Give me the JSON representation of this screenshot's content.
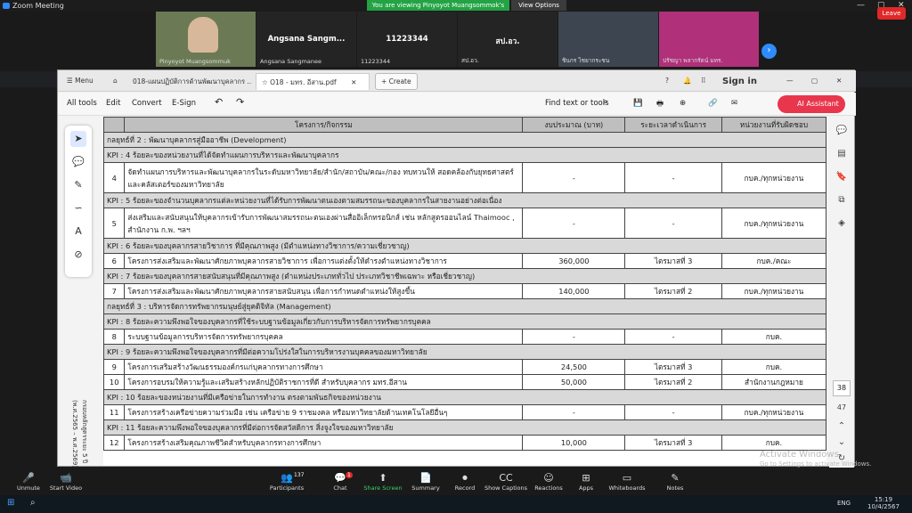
{
  "zoom": {
    "title": "Zoom Meeting",
    "share_banner": "You are viewing Pinyoyot Muangsommok's screen",
    "view_options": "View Options",
    "participants": [
      {
        "name": "Pinyoyot Muangsommuk",
        "big": ""
      },
      {
        "name": "Angsana Sangmanee",
        "big": "Angsana Sangm..."
      },
      {
        "name": "11223344",
        "big": "11223344"
      },
      {
        "name": "สป.อว.",
        "big": "สป.อว."
      },
      {
        "name": "ชินกร ไชยากระชน",
        "big": ""
      },
      {
        "name": "ปรัชญา พลากรัตน์ มทร.",
        "big": ""
      }
    ],
    "bottom": [
      {
        "label": "Unmute",
        "icon": "mic-off-icon",
        "glyph": "🎤"
      },
      {
        "label": "Start Video",
        "icon": "video-off-icon",
        "glyph": "📹"
      },
      {
        "label": "Participants",
        "icon": "participants-icon",
        "glyph": "👥",
        "badge": "137"
      },
      {
        "label": "Chat",
        "icon": "chat-icon",
        "glyph": "💬",
        "badge": "1"
      },
      {
        "label": "Share Screen",
        "icon": "share-icon",
        "glyph": "⬆"
      },
      {
        "label": "Summary",
        "icon": "summary-icon",
        "glyph": "📄"
      },
      {
        "label": "Record",
        "icon": "record-icon",
        "glyph": "⏺"
      },
      {
        "label": "Show Captions",
        "icon": "captions-icon",
        "glyph": "CC"
      },
      {
        "label": "Reactions",
        "icon": "reactions-icon",
        "glyph": "☺"
      },
      {
        "label": "Apps",
        "icon": "apps-icon",
        "glyph": "⊞"
      },
      {
        "label": "Whiteboards",
        "icon": "whiteboard-icon",
        "glyph": "▭"
      },
      {
        "label": "Notes",
        "icon": "notes-icon",
        "glyph": "✎"
      }
    ],
    "leave": "Leave"
  },
  "pdf": {
    "tabs": [
      "Menu",
      "018-แผนปฏิบัติการด้านพัฒนาบุคลากร ...",
      "O18 - มทร. อีสาน.pdf",
      "Create"
    ],
    "toolbar": [
      "All tools",
      "Edit",
      "Convert",
      "E-Sign"
    ],
    "find": "Find text or tools",
    "sign_in": "Sign in",
    "ai_assistant": "AI Assistant",
    "page_current": "38",
    "page_total": "47",
    "side_text": "กรอบหลักสูตรระยะ 5 ปี (พ.ศ.2565 – พ.ศ.2569)",
    "headers": [
      "",
      "โครงการ/กิจกรรม",
      "งบประมาณ (บาท)",
      "ระยะเวลาดำเนินการ",
      "หน่วยงานที่รับผิดชอบ"
    ],
    "rows": [
      {
        "kind": "grp",
        "text": "กลยุทธ์ที่ 2 : พัฒนาบุคลากรสู่มืออาชีพ (Development)"
      },
      {
        "kind": "kpi",
        "text": "KPI : 4 ร้อยละของหน่วยงานที่ได้จัดทำแผนการบริหารและพัฒนาบุคลากร"
      },
      {
        "kind": "row",
        "no": "4",
        "text": "จัดทำแผนการบริหารและพัฒนาบุคลากรในระดับมหาวิทยาลัย/สำนัก/สถาบัน/คณะ/กอง ทบทวนให้ สอดคล้องกับยุทธศาสตร์และคลัสเตอร์ของมหาวิทยาลัย",
        "budget": "-",
        "period": "-",
        "unit": "กบค./ทุกหน่วยงาน",
        "tall": true
      },
      {
        "kind": "kpi",
        "text": "KPI : 5 ร้อยละของจำนวนบุคลากรแต่ละหน่วยงานที่ได้รับการพัฒนาตนเองตามสมรรถนะของบุคลากรในสายงานอย่างต่อเนื่อง"
      },
      {
        "kind": "row",
        "no": "5",
        "text": "ส่งเสริมและสนับสนุนให้บุคลากรเข้ารับการพัฒนาสมรรถนะตนเองผ่านสื่ออิเล็กทรอนิกส์ เช่น หลักสูตรออนไลน์ Thaimooc , สำนักงาน ก.พ. ฯลฯ",
        "budget": "-",
        "period": "-",
        "unit": "กบค./ทุกหน่วยงาน",
        "tall": true
      },
      {
        "kind": "kpi",
        "text": "KPI : 6 ร้อยละของบุคลากรสายวิชาการ ที่มีคุณภาพสูง (มีตำแหน่งทางวิชาการ/ความเชี่ยวชาญ)"
      },
      {
        "kind": "row",
        "no": "6",
        "text": "โครงการส่งเสริมและพัฒนาศักยภาพบุคลากรสายวิชาการ เพื่อการแต่งตั้งให้ดำรงตำแหน่งทางวิชาการ",
        "budget": "360,000",
        "period": "ไตรมาสที่ 3",
        "unit": "กบค./คณะ"
      },
      {
        "kind": "kpi",
        "text": "KPI : 7 ร้อยละของบุคลากรสายสนับสนุนที่มีคุณภาพสูง (ตำแหน่งประเภททั่วไป ประเภทวิชาชีพเฉพาะ หรือเชี่ยวชาญ)"
      },
      {
        "kind": "row",
        "no": "7",
        "text": "โครงการส่งเสริมและพัฒนาศักยภาพบุคลากรสายสนับสนุน เพื่อการกำหนดตำแหน่งให้สูงขึ้น",
        "budget": "140,000",
        "period": "ไตรมาสที่ 2",
        "unit": "กบค./ทุกหน่วยงาน"
      },
      {
        "kind": "grp",
        "text": "กลยุทธ์ที่ 3 : บริหารจัดการทรัพยากรมนุษย์สู่ยุคดิจิทัล (Management)"
      },
      {
        "kind": "kpi",
        "text": "KPI : 8 ร้อยละความพึงพอใจของบุคลากรที่ใช้ระบบฐานข้อมูลเกี่ยวกับการบริหารจัดการทรัพยากรบุคคล"
      },
      {
        "kind": "row",
        "no": "8",
        "text": "ระบบฐานข้อมูลการบริหารจัดการทรัพยากรบุคคล",
        "budget": "-",
        "period": "-",
        "unit": "กบค."
      },
      {
        "kind": "kpi",
        "text": "KPI : 9 ร้อยละความพึงพอใจของบุคลากรที่มีต่อความโปร่งใสในการบริหารงานบุคคลของมหาวิทยาลัย"
      },
      {
        "kind": "row",
        "no": "9",
        "text": "โครงการเสริมสร้างวัฒนธรรมองค์กรแก่บุคลากรทางการศึกษา",
        "budget": "24,500",
        "period": "ไตรมาสที่ 3",
        "unit": "กบค."
      },
      {
        "kind": "row",
        "no": "10",
        "text": "โครงการอบรมให้ความรู้และเสริมสร้างหลักปฏิบัติราชการที่ดี สำหรับบุคลากร มทร.อีสาน",
        "budget": "50,000",
        "period": "ไตรมาสที่ 2",
        "unit": "สำนักงานกฎหมาย"
      },
      {
        "kind": "kpi",
        "text": "KPI : 10 ร้อยละของหน่วยงานที่มีเครือข่ายในการทำงาน ตรงตามพันธกิจของหน่วยงาน"
      },
      {
        "kind": "row",
        "no": "11",
        "text": "โครงการสร้างเครือข่ายความร่วมมือ เช่น เครือข่าย 9 ราชมงคล หรือมหาวิทยาลัยด้านเทคโนโลยีอื่นๆ",
        "budget": "-",
        "period": "-",
        "unit": "กบค./ทุกหน่วยงาน"
      },
      {
        "kind": "kpi",
        "text": "KPI : 11 ร้อยละความพึงพอใจของบุคลากรที่มีต่อการจัดสวัสดิการ สิ่งจูงใจของมหาวิทยาลัย"
      },
      {
        "kind": "row",
        "no": "12",
        "text": "โครงการสร้างเสริมคุณภาพชีวิตสำหรับบุคลากรทางการศึกษา",
        "budget": "10,000",
        "period": "ไตรมาสที่ 3",
        "unit": "กบค."
      }
    ]
  },
  "watermark": {
    "line1": "Activate Windows",
    "line2": "Go to Settings to activate Windows."
  },
  "taskbar": {
    "lang": "ENG",
    "time": "15:19",
    "date": "10/4/2567"
  }
}
